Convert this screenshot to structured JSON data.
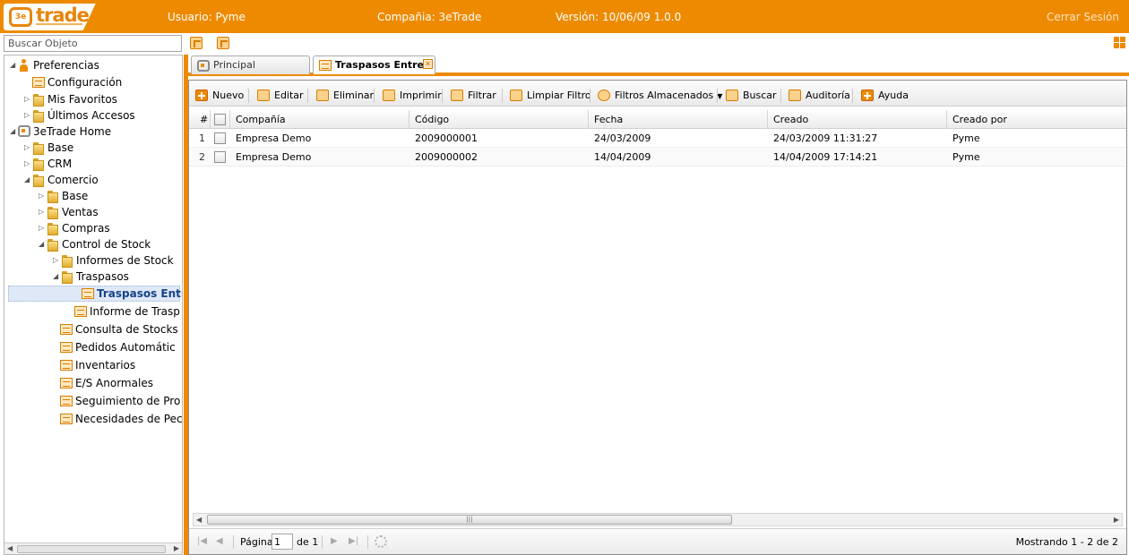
{
  "header": {
    "logo_text": "trade",
    "logo_mark": "3e",
    "user": "Usuario: Pyme",
    "company": "Compañia: 3eTrade",
    "version": "Versión: 10/06/09 1.0.0",
    "logout": "Cerrar Sesión",
    "accent_color": "#ee8a00"
  },
  "search": {
    "placeholder": "Buscar Objeto"
  },
  "tree": [
    {
      "label": "Preferencias",
      "icon": "person-icon",
      "arrow": "◢"
    },
    {
      "label": "Configuración",
      "icon": "grid-icon",
      "arrow": ""
    },
    {
      "label": "Mis Favoritos",
      "icon": "folder-icon",
      "arrow": "▷"
    },
    {
      "label": "Últimos Accesos",
      "icon": "folder-icon",
      "arrow": "▷"
    },
    {
      "label": "3eTrade Home",
      "icon": "home-icon",
      "arrow": "◢"
    },
    {
      "label": "Base",
      "icon": "folder-icon",
      "arrow": "▷"
    },
    {
      "label": "CRM",
      "icon": "folder-icon",
      "arrow": "▷"
    },
    {
      "label": "Comercio",
      "icon": "folder-icon",
      "arrow": "◢"
    },
    {
      "label": "Base",
      "icon": "folder-icon",
      "arrow": "▷"
    },
    {
      "label": "Ventas",
      "icon": "folder-icon",
      "arrow": "▷"
    },
    {
      "label": "Compras",
      "icon": "folder-icon",
      "arrow": "▷"
    },
    {
      "label": "Control de Stock",
      "icon": "folder-icon",
      "arrow": "◢"
    },
    {
      "label": "Informes de Stock",
      "icon": "folder-icon",
      "arrow": "▷"
    },
    {
      "label": "Traspasos",
      "icon": "folder-icon",
      "arrow": "◢"
    },
    {
      "label": "Traspasos Entr",
      "icon": "grid-icon",
      "arrow": ""
    },
    {
      "label": "Informe de Trasp",
      "icon": "grid-icon",
      "arrow": ""
    },
    {
      "label": "Consulta de Stocks",
      "icon": "grid-icon",
      "arrow": ""
    },
    {
      "label": "Pedidos Automátic",
      "icon": "grid-icon",
      "arrow": ""
    },
    {
      "label": "Inventarios",
      "icon": "grid-icon",
      "arrow": ""
    },
    {
      "label": "E/S Anormales",
      "icon": "grid-icon",
      "arrow": ""
    },
    {
      "label": "Seguimiento de Pro",
      "icon": "grid-icon",
      "arrow": ""
    },
    {
      "label": "Necesidades de Pec",
      "icon": "grid-icon",
      "arrow": ""
    }
  ],
  "tabs": [
    {
      "label": "Principal"
    },
    {
      "label": "Traspasos Entre"
    }
  ],
  "toolbar": {
    "nuevo": "Nuevo",
    "editar": "Editar",
    "eliminar": "Eliminar",
    "imprimir": "Imprimir",
    "filtrar": "Filtrar",
    "limpiar": "Limpiar Filtro",
    "filtros": "Filtros Almacenados",
    "buscar": "Buscar",
    "auditoria": "Auditoría",
    "ayuda": "Ayuda"
  },
  "grid": {
    "columns": [
      "#",
      "Compañía",
      "Código",
      "Fecha",
      "Creado",
      "Creado por"
    ],
    "rows": [
      {
        "n": "1",
        "company": "Empresa Demo",
        "code": "2009000001",
        "date": "24/03/2009",
        "created": "24/03/2009 11:31:27",
        "by": "Pyme"
      },
      {
        "n": "2",
        "company": "Empresa Demo",
        "code": "2009000002",
        "date": "14/04/2009",
        "created": "14/04/2009 17:14:21",
        "by": "Pyme"
      }
    ]
  },
  "paging": {
    "page_label": "Página",
    "page_value": "1",
    "of_label": "de 1",
    "info": "Mostrando 1 - 2 de 2"
  }
}
